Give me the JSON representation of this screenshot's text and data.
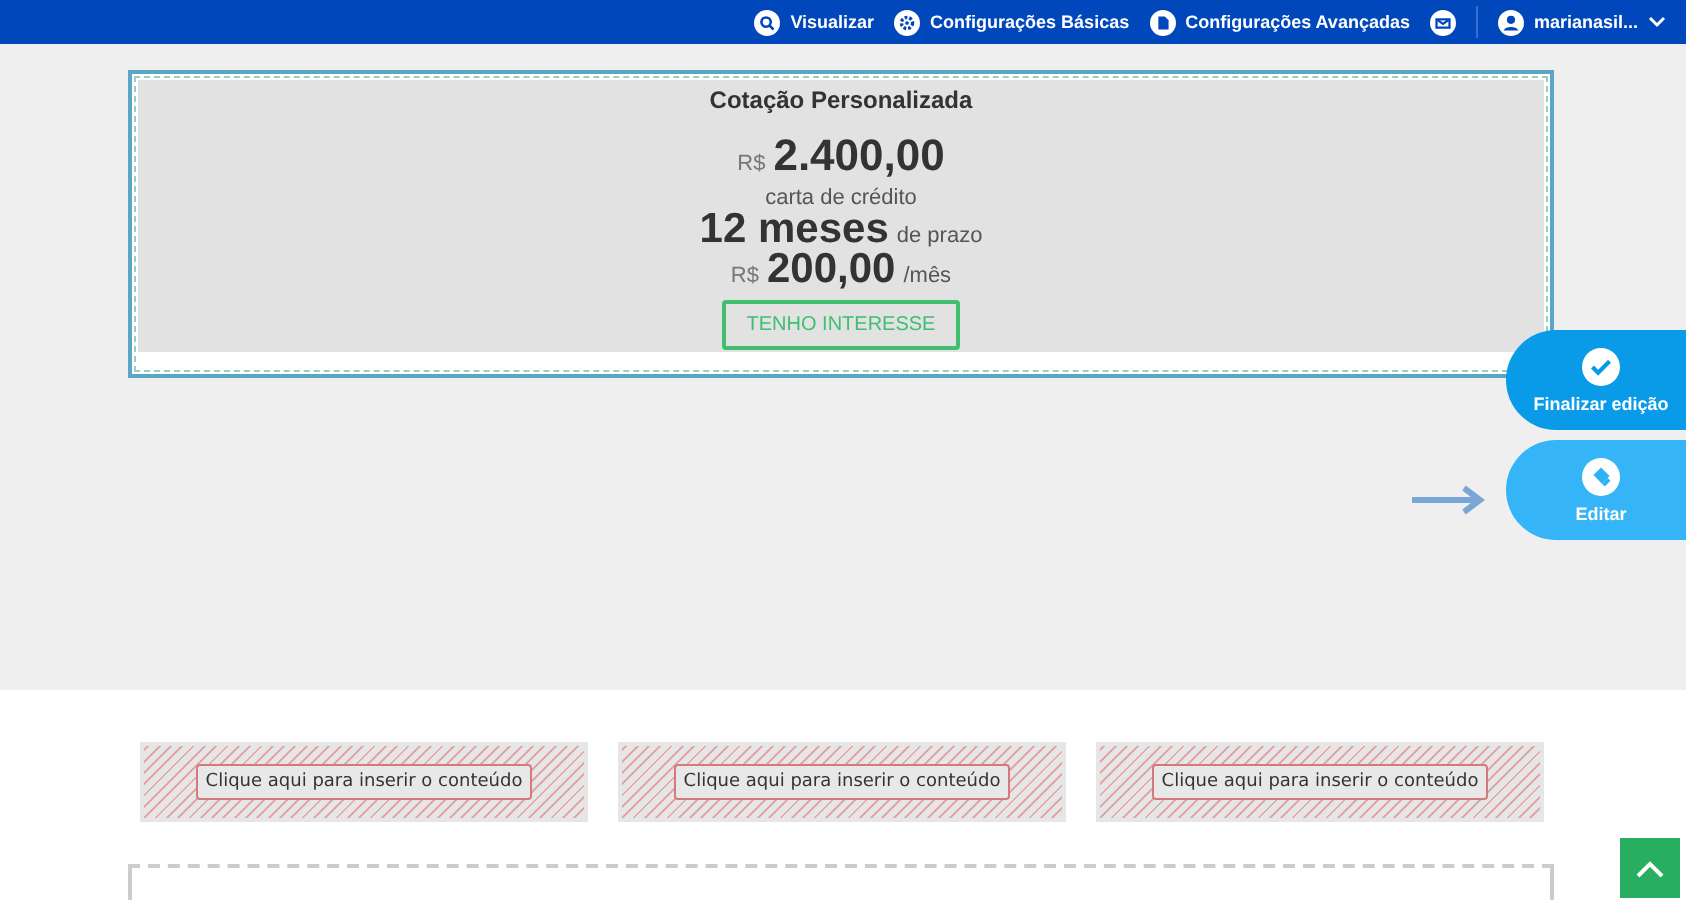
{
  "topbar": {
    "items": [
      {
        "kind": "preview",
        "label": "Visualizar"
      },
      {
        "kind": "gear",
        "label": "Configurações Básicas"
      },
      {
        "kind": "file",
        "label": "Configurações Avançadas"
      }
    ],
    "user": "marianasil..."
  },
  "quote": {
    "title": "Cotação Personalizada",
    "currency": "R$",
    "amount": "2.400,00",
    "caption": "carta de crédito",
    "term": "12 meses",
    "term_suffix": "de prazo",
    "installment_currency": "R$",
    "installment": "200,00",
    "installment_suffix": "/mês",
    "button": "TENHO INTERESSE"
  },
  "floating_buttons": [
    {
      "kind": "check",
      "label": "Finalizar edição"
    },
    {
      "kind": "edit",
      "label": "Editar"
    }
  ],
  "placeholders": [
    "Clique aqui para inserir o conteúdo",
    "Clique aqui para inserir o conteúdo",
    "Clique aqui para inserir o conteúdo"
  ]
}
